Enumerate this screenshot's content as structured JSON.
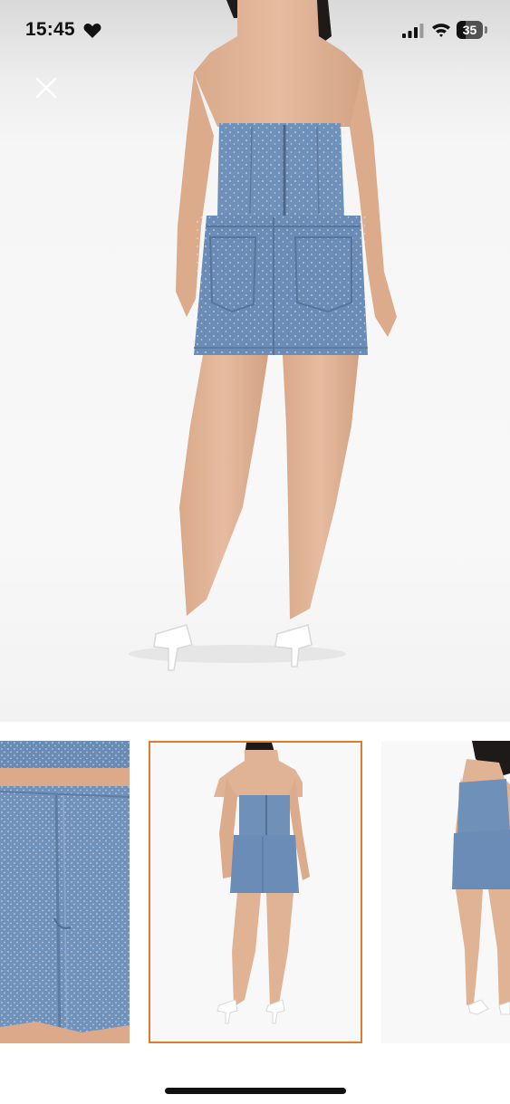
{
  "status_bar": {
    "time": "15:45",
    "battery": "35",
    "battery_level": 0.35,
    "icons": [
      "heart-icon",
      "cellular-signal-icon",
      "wifi-icon",
      "battery-icon"
    ]
  },
  "viewer": {
    "close_icon": "close-icon",
    "selected_thumbnail": 2,
    "thumbnails": [
      {
        "name": "thumbnail-detail-closeup",
        "selected": false
      },
      {
        "name": "thumbnail-back-view",
        "selected": true
      },
      {
        "name": "thumbnail-side-view",
        "selected": false
      }
    ]
  },
  "colors": {
    "selected_border": "#e07a2e",
    "denim": "#6f90b8",
    "skin": "#e0b394"
  }
}
